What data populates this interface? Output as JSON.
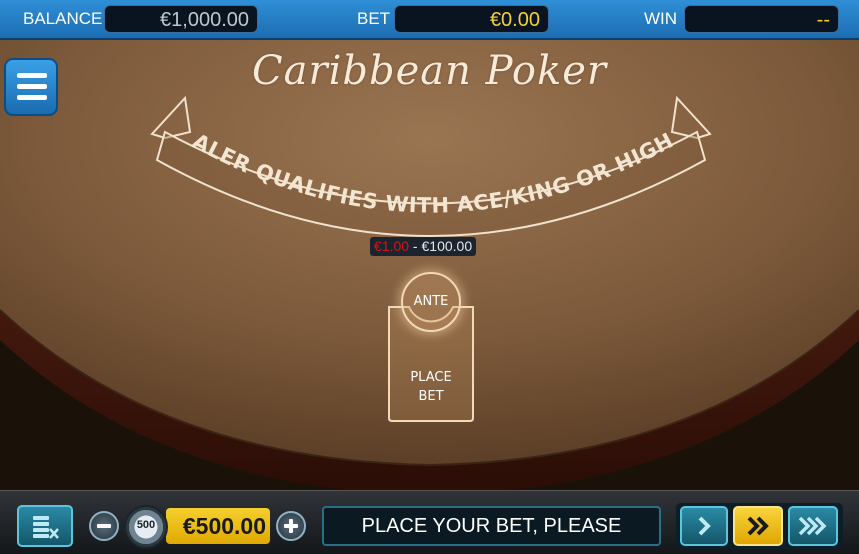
{
  "topbar": {
    "balance_label": "BALANCE",
    "balance_value": "€1,000.00",
    "bet_label": "BET",
    "bet_value": "€0.00",
    "win_label": "WIN",
    "win_value": "--"
  },
  "table": {
    "title": "Caribbean Poker",
    "banner_text": "DEALER QUALIFIES WITH ACE/KING OR HIGHER",
    "bet_range_min": "€1.00",
    "bet_range_sep": " - ",
    "bet_range_max": "€100.00",
    "ante_label": "ANTE",
    "place_bet_line1": "PLACE",
    "place_bet_line2": "BET"
  },
  "controls": {
    "chip_face": "500",
    "chip_value": "€500.00",
    "message": "PLACE YOUR BET, PLEASE",
    "speed_selected": 2
  },
  "colors": {
    "accent_blue": "#1c6db3",
    "bet_yellow": "#f5d030",
    "felt_brown": "#7a5a3c",
    "teal": "#2a8aa5"
  },
  "icons": [
    "menu-icon",
    "clear-bets-icon",
    "minus-icon",
    "plus-icon",
    "chip-icon",
    "speed-normal-icon",
    "speed-fast-icon",
    "speed-turbo-icon"
  ]
}
